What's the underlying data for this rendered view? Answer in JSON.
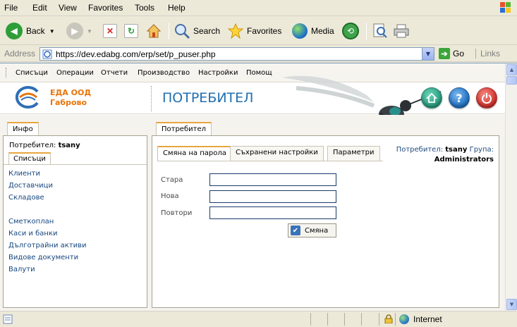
{
  "ie": {
    "menu": [
      "File",
      "Edit",
      "View",
      "Favorites",
      "Tools",
      "Help"
    ],
    "toolbar": {
      "back": "Back",
      "search": "Search",
      "favorites": "Favorites",
      "media": "Media"
    },
    "address": {
      "label": "Address",
      "url": "https://dev.edabg.com/erp/set/p_puser.php",
      "go": "Go",
      "links": "Links"
    },
    "status": {
      "zone": "Internet"
    }
  },
  "app": {
    "menu": [
      "Списъци",
      "Операции",
      "Отчети",
      "Производство",
      "Настройки",
      "Помощ"
    ],
    "company": {
      "name": "ЕДА ООД",
      "city": "Габрово"
    },
    "page_title": "ПОТРЕБИТЕЛ",
    "left": {
      "tab": "Инфо",
      "user_label": "Потребител:",
      "user_name": "tsany",
      "lists_tab": "Списъци",
      "links_group1": [
        "Клиенти",
        "Доставчици",
        "Складове"
      ],
      "links_group2": [
        "Сметкоплан",
        "Каси и банки",
        "Дълготрайни активи",
        "Видове документи",
        "Валути"
      ]
    },
    "right": {
      "tab": "Потребител",
      "subtabs": [
        "Смяна на парола",
        "Съхранени настройки",
        "Параметри"
      ],
      "user_label": "Потребител:",
      "user_name": "tsany",
      "group_label": "Група:",
      "group_name": "Administrators",
      "fields": {
        "old_label": "Стара",
        "new_label": "Нова",
        "repeat_label": "Повтори",
        "old_value": "",
        "new_value": "",
        "repeat_value": ""
      },
      "change_button": "Смяна"
    }
  },
  "colors": {
    "accent_orange": "#e8a53d",
    "company_orange": "#e8740a",
    "title_blue": "#1f6fb1",
    "home_green": "#2fa186",
    "help_blue": "#2a78c8",
    "power_red": "#d93a34"
  }
}
